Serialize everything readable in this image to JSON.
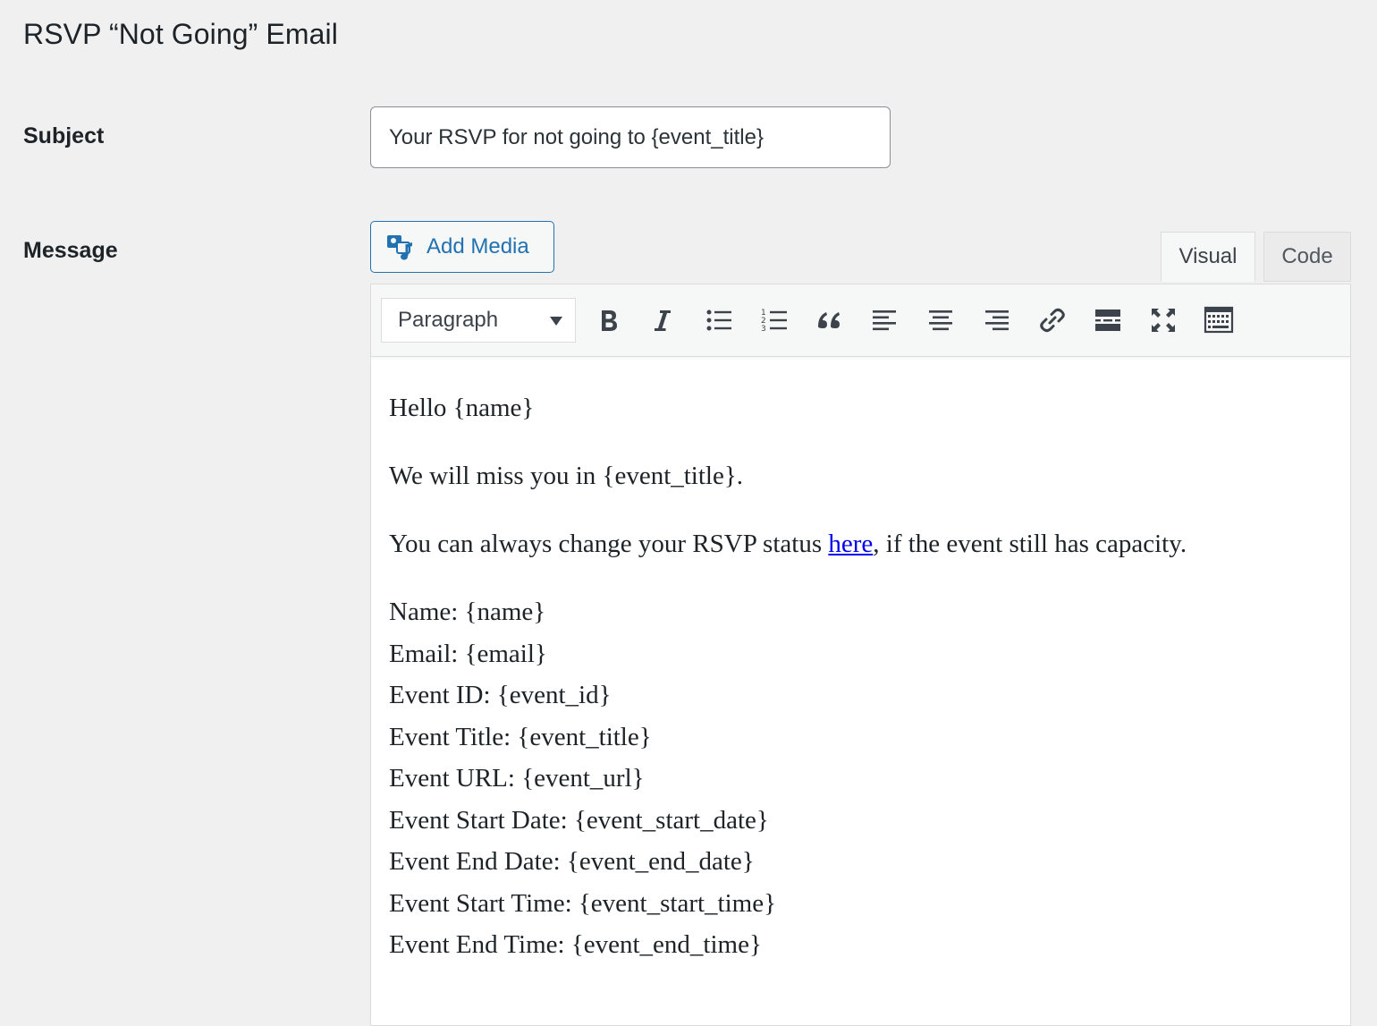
{
  "page": {
    "title": "RSVP “Not Going” Email"
  },
  "subject": {
    "label": "Subject",
    "value": "Your RSVP for not going to {event_title}"
  },
  "message": {
    "label": "Message",
    "add_media_label": "Add Media",
    "tabs": {
      "visual": "Visual",
      "code": "Code"
    },
    "active_tab": "Visual",
    "toolbar": {
      "format_value": "Paragraph",
      "buttons": [
        "bold-icon",
        "italic-icon",
        "bulleted-list-icon",
        "numbered-list-icon",
        "blockquote-icon",
        "align-left-icon",
        "align-center-icon",
        "align-right-icon",
        "link-icon",
        "read-more-icon",
        "fullscreen-icon",
        "toolbar-toggle-icon"
      ]
    },
    "body": {
      "greeting": "Hello {name}",
      "miss": "We will miss you in {event_title}.",
      "change_before": "You can always change your RSVP status ",
      "change_link": "here",
      "change_after": ", if the event still has capacity.",
      "fields": [
        "Name: {name}",
        "Email: {email}",
        "Event ID: {event_id}",
        "Event Title: {event_title}",
        "Event URL: {event_url}",
        "Event Start Date: {event_start_date}",
        "Event End Date: {event_end_date}",
        "Event Start Time: {event_start_time}",
        "Event End Time: {event_end_time}"
      ]
    }
  },
  "colors": {
    "background": "#f0f0f1",
    "accent": "#2271b1",
    "link": "#0000ee",
    "text": "#1d2327"
  }
}
